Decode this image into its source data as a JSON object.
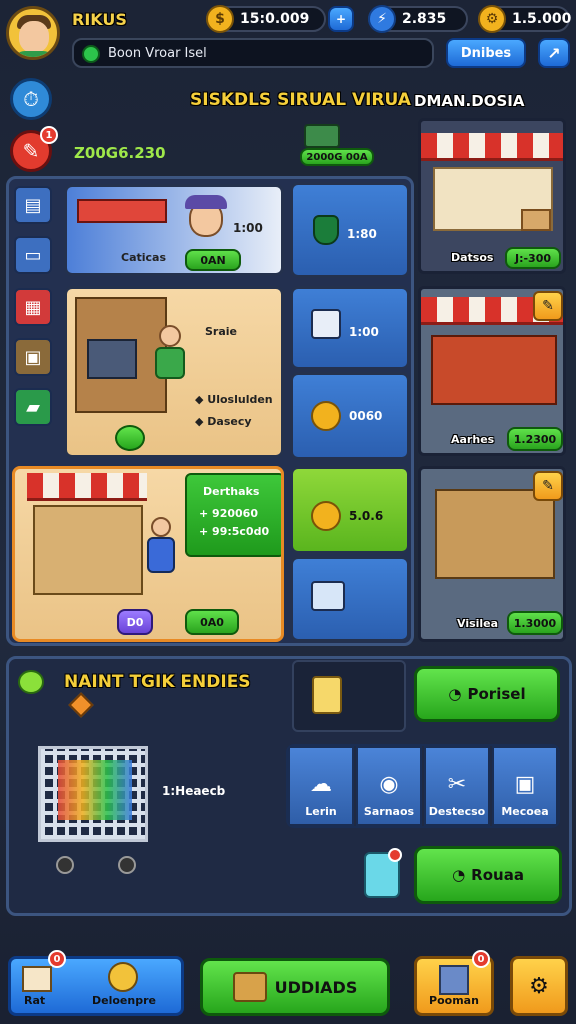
{
  "player": {
    "name": "RIKUS",
    "avatar_icon": "player-avatar"
  },
  "currencies": [
    {
      "icon": "coin-icon",
      "value": "15:0.009",
      "color": "#f2b21e"
    },
    {
      "icon": "cash-icon",
      "value": "2.835",
      "color": "#2f7ae0"
    },
    {
      "icon": "gear-icon",
      "value": "1.5.000",
      "color": "#f2b21e"
    }
  ],
  "header": {
    "message": "Boon Vroar Isel",
    "right_button": "Dnibes",
    "title": "SISKDLS SIRUAL VIRUA",
    "title_right": "DMAN.DOSIA",
    "balance": "Z00G6.230",
    "center_value": "2000G 00A"
  },
  "grid": {
    "row1": {
      "promo_price": "1:00",
      "promo_name": "Caticas",
      "promo_pill": "0AN",
      "middle_price": "1:80",
      "shop_name": "Datsos",
      "shop_price": "J:-300"
    },
    "row2": {
      "left_title": "Sraie",
      "bullet1": "Uloslulden",
      "bullet2": "Dasecy",
      "middle_price1": "1:00",
      "middle_price2": "0060",
      "shop_name": "Aarhes",
      "shop_price": "1.2300"
    },
    "row3": {
      "panel_title": "Derthaks",
      "stat1": "+ 920060",
      "stat2": "+ 99:5c0d0",
      "purple_label": "D0",
      "green_label": "0A0",
      "middle_price": "5.0.6",
      "shop_name": "Visilea",
      "shop_price": "1.3000"
    }
  },
  "bottom_section": {
    "title": "NAINT TGIK ENDIES",
    "cart_label": "1:Heaecb",
    "top_button": "Porisel",
    "categories": [
      {
        "label": "Lerin",
        "icon": "cloud-icon"
      },
      {
        "label": "Sarnaos",
        "icon": "scanner-icon"
      },
      {
        "label": "Destecso",
        "icon": "tools-icon"
      },
      {
        "label": "Mecoea",
        "icon": "box-icon"
      }
    ],
    "bottom_button": "Rouaa"
  },
  "nav": {
    "home": "Rat",
    "home_badge": "0",
    "employees": "Deloenpre",
    "center": "UDDIADS",
    "inventory": "Pooman",
    "inventory_badge": "0",
    "settings": ""
  }
}
